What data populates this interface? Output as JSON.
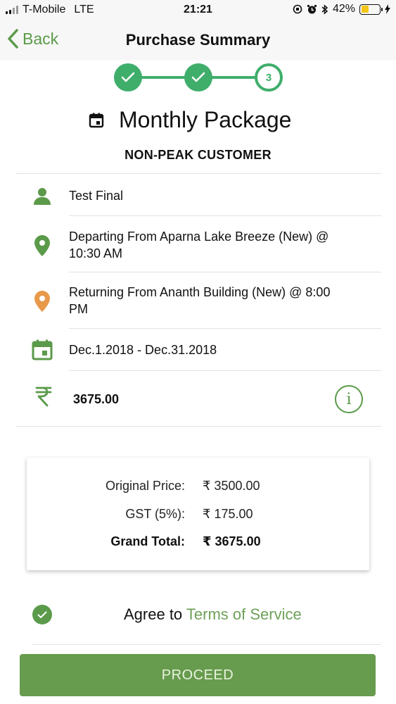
{
  "status_bar": {
    "carrier": "T-Mobile",
    "network": "LTE",
    "time": "21:21",
    "battery": "42%",
    "battery_level": 0.42,
    "battery_color": "#f5c518"
  },
  "nav": {
    "back_label": "Back",
    "title": "Purchase Summary"
  },
  "stepper": {
    "steps": [
      {
        "state": "completed",
        "icon": "check-icon"
      },
      {
        "state": "completed",
        "icon": "check-icon"
      },
      {
        "state": "current",
        "label": "3"
      }
    ],
    "color": "#3fae6b"
  },
  "package": {
    "icon": "calendar-icon",
    "title": "Monthly Package",
    "customer_type": "NON-PEAK CUSTOMER"
  },
  "details": {
    "passenger": {
      "icon": "person-icon",
      "text": "Test Final"
    },
    "departing": {
      "icon": "location-pin-icon",
      "text_line1": "Departing From Aparna Lake Breeze (New) @",
      "text_line2": "10:30 AM",
      "icon_color": "#5b9a4a"
    },
    "returning": {
      "icon": "location-pin-icon",
      "text_line1": "Returning From Ananth Building (New) @ 8:00",
      "text_line2": "PM",
      "icon_color": "#e8994a"
    },
    "dates": {
      "icon": "calendar-icon",
      "text": "Dec.1.2018 - Dec.31.2018"
    },
    "amount": {
      "icon": "rupee-icon",
      "text": "3675.00",
      "info_icon": "info-icon"
    }
  },
  "price_breakdown": {
    "original_label": "Original Price:",
    "original_value": "₹ 3500.00",
    "gst_label": "GST (5%):",
    "gst_value": "₹ 175.00",
    "total_label": "Grand Total:",
    "total_value": "₹ 3675.00"
  },
  "agreement": {
    "checked": true,
    "prefix": "Agree to ",
    "link": "Terms of Service"
  },
  "proceed_label": "PROCEED",
  "colors": {
    "brand_green": "#5b9a4a",
    "button_green": "#679b4d",
    "step_green": "#3fae6b"
  }
}
